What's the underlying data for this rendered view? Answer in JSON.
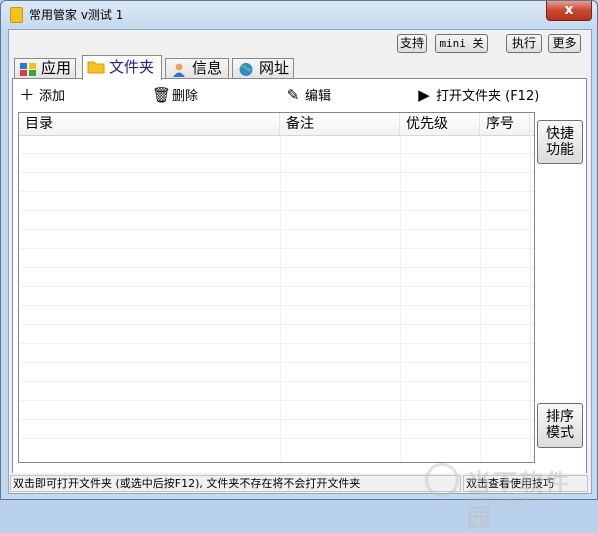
{
  "window": {
    "title": "常用管家 v测试 1",
    "close_label": "x"
  },
  "toolbar_top": {
    "support": "支持",
    "mini": "mini 关",
    "execute": "执行",
    "more": "更多"
  },
  "tabs": [
    {
      "label": "应用",
      "icon": "apps-icon"
    },
    {
      "label": "文件夹",
      "icon": "folder-icon",
      "active": true
    },
    {
      "label": "信息",
      "icon": "person-icon"
    },
    {
      "label": "网址",
      "icon": "globe-icon"
    }
  ],
  "actions": {
    "add": "添加",
    "delete": "删除",
    "edit": "编辑",
    "open": "打开文件夹 (F12)"
  },
  "list": {
    "columns": [
      "目录",
      "备注",
      "优先级",
      "序号"
    ],
    "rows": []
  },
  "side_buttons": {
    "quick_line1": "快捷",
    "quick_line2": "功能",
    "sort_line1": "排序",
    "sort_line2": "模式"
  },
  "status": {
    "left": "双击即可打开文件夹 (或选中后按F12), 文件夹不存在将不会打开文件夹",
    "right": "双击查看使用技巧"
  },
  "watermark": {
    "name": "当下软件园",
    "url": "www.downxia.com"
  },
  "colors": {
    "accent_tab_text": "#1a1ab0",
    "close_button": "#c9472f"
  }
}
